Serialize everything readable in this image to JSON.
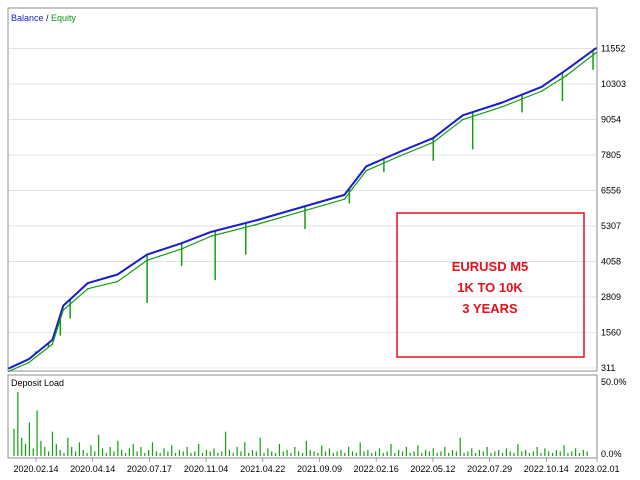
{
  "legend": {
    "balance": "Balance",
    "separator": " / ",
    "equity": "Equity"
  },
  "sub_panel_title": "Deposit Load",
  "annotation": [
    "EURUSD M5",
    "1K TO 10K",
    "3 YEARS"
  ],
  "colors": {
    "balance": "#1b1bd0",
    "equity": "#10a010",
    "load": "#10a010",
    "annotation": "#e8101a",
    "grid": "#cfcfcf"
  },
  "chart_data": [
    {
      "type": "line",
      "title": "",
      "series": [
        {
          "name": "Balance",
          "x": [
            0,
            20,
            44,
            55,
            80,
            110,
            140,
            175,
            205,
            250,
            300,
            340,
            362,
            395,
            430,
            460,
            500,
            540,
            565,
            595
          ],
          "y": [
            300,
            620,
            1300,
            2500,
            3300,
            3600,
            4300,
            4700,
            5100,
            5500,
            6000,
            6400,
            7400,
            7900,
            8400,
            9200,
            9650,
            10200,
            10800,
            11560
          ]
        },
        {
          "name": "Equity",
          "x": [
            0,
            20,
            44,
            55,
            80,
            110,
            140,
            175,
            205,
            250,
            300,
            340,
            362,
            395,
            430,
            460,
            500,
            540,
            565,
            595
          ],
          "y": [
            200,
            500,
            1150,
            2350,
            3100,
            3350,
            4100,
            4500,
            4950,
            5350,
            5850,
            6250,
            7250,
            7750,
            8250,
            9050,
            9500,
            10050,
            10600,
            11400
          ]
        }
      ],
      "dips": [
        [
          27,
          900
        ],
        [
          40,
          1050
        ],
        [
          52,
          1450
        ],
        [
          62,
          2050
        ],
        [
          140,
          2600
        ],
        [
          175,
          3900
        ],
        [
          209,
          3400
        ],
        [
          240,
          4300
        ],
        [
          300,
          5200
        ],
        [
          345,
          6100
        ],
        [
          380,
          7200
        ],
        [
          430,
          7600
        ],
        [
          470,
          8000
        ],
        [
          520,
          9300
        ],
        [
          561,
          9700
        ],
        [
          592,
          10800
        ]
      ],
      "xlabels": [
        "2020.02.14",
        "2020.04.14",
        "2020.07.17",
        "2020.11.04",
        "2021.04.22",
        "2021.09.09",
        "2022.02.16",
        "2022.05.12",
        "2022.07.29",
        "2022.10.14",
        "2023.02.01"
      ],
      "yticks": [
        311,
        1560,
        2809,
        4058,
        5307,
        6556,
        7805,
        9054,
        10303,
        11552
      ],
      "ylim": [
        311,
        12200
      ]
    },
    {
      "type": "bar",
      "title": "Deposit Load",
      "yticks": [
        "0.0%",
        "50.0%"
      ],
      "ylim": [
        0,
        50
      ],
      "values": [
        18,
        42,
        12,
        8,
        22,
        5,
        30,
        10,
        6,
        3,
        16,
        8,
        4,
        2,
        12,
        6,
        3,
        9,
        4,
        2,
        7,
        3,
        14,
        5,
        2,
        6,
        3,
        10,
        4,
        2,
        5,
        8,
        3,
        6,
        2,
        4,
        9,
        3,
        2,
        5,
        3,
        7,
        2,
        4,
        3,
        6,
        2,
        3,
        8,
        2,
        4,
        3,
        5,
        2,
        3,
        16,
        4,
        2,
        6,
        3,
        9,
        2,
        4,
        3,
        12,
        2,
        5,
        3,
        2,
        8,
        3,
        4,
        2,
        6,
        3,
        2,
        10,
        4,
        3,
        2,
        7,
        3,
        5,
        2,
        3,
        4,
        2,
        6,
        3,
        2,
        9,
        3,
        4,
        2,
        3,
        5,
        2,
        3,
        8,
        2,
        4,
        3,
        6,
        2,
        3,
        7,
        2,
        4,
        3,
        5,
        2,
        3,
        6,
        2,
        4,
        3,
        12,
        2,
        3,
        5,
        2,
        4,
        3,
        6,
        2,
        3,
        4,
        2,
        5,
        3,
        2,
        8,
        3,
        4,
        2,
        3,
        6,
        2,
        5,
        3,
        2,
        4,
        3,
        7,
        2,
        3,
        5,
        2,
        4,
        3
      ]
    }
  ]
}
